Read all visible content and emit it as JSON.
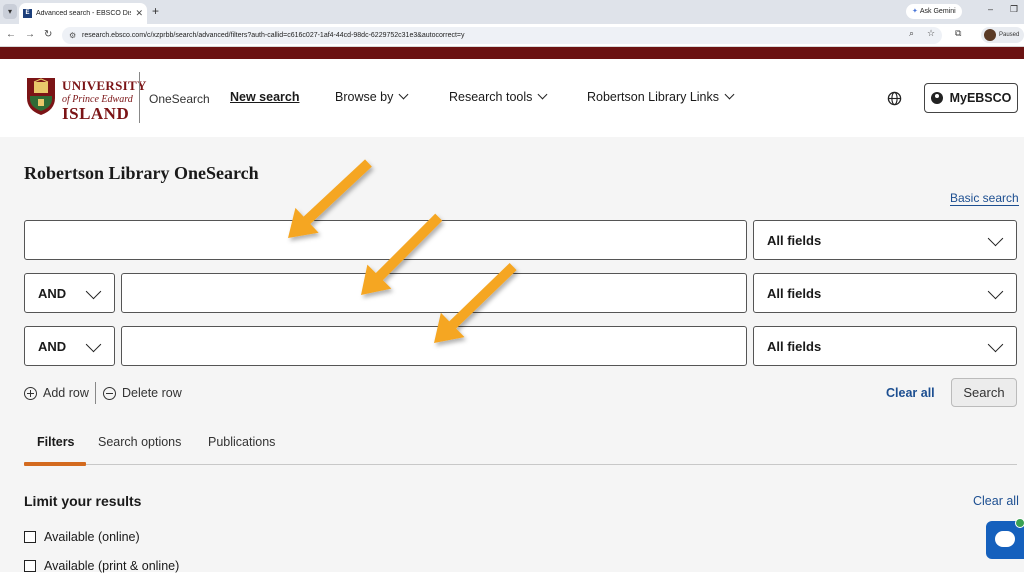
{
  "browser": {
    "tab_title": "Advanced search - EBSCO Disc",
    "tab_favicon": "E",
    "new_tab_symbol": "+",
    "gemini_label": "Ask Gemini",
    "url": "research.ebsco.com/c/xzprbb/search/advanced/filters?auth-callid=c616c027-1af4-44cd-98dc-6229752c31e3&autocorrect=y",
    "profile_status": "Paused"
  },
  "header": {
    "logo": {
      "line1": "UNIVERSITY",
      "line2": "of Prince Edward",
      "line3": "ISLAND"
    },
    "product_name": "OneSearch",
    "nav": {
      "new_search": "New search",
      "browse_by": "Browse by",
      "research_tools": "Research tools",
      "robertson_links": "Robertson Library Links"
    },
    "account_label": "MyEBSCO"
  },
  "search": {
    "title": "Robertson Library OneSearch",
    "basic_search_link": "Basic search",
    "rows": [
      {
        "operator": "",
        "query": "",
        "field": "All fields"
      },
      {
        "operator": "AND",
        "query": "",
        "field": "All fields"
      },
      {
        "operator": "AND",
        "query": "",
        "field": "All fields"
      }
    ],
    "add_row": "Add row",
    "delete_row": "Delete row",
    "clear_all": "Clear all",
    "search_button": "Search"
  },
  "tabs": [
    {
      "label": "Filters",
      "active": true
    },
    {
      "label": "Search options",
      "active": false
    },
    {
      "label": "Publications",
      "active": false
    }
  ],
  "limits": {
    "title": "Limit your results",
    "clear_all": "Clear all",
    "options": [
      {
        "label": "Available (online)",
        "checked": false
      },
      {
        "label": "Available (print & online)",
        "checked": false
      }
    ]
  },
  "colors": {
    "brand_maroon": "#6b1212",
    "link_blue": "#1d4f91",
    "accent_orange": "#d36a1e",
    "annotation_arrow": "#f5a623",
    "chat_blue": "#1560bd"
  }
}
